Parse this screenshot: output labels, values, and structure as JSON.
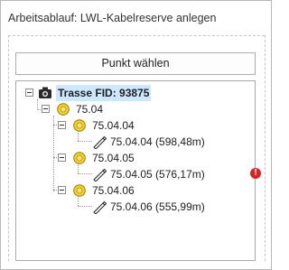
{
  "panel": {
    "title": "Arbeitsablauf: LWL-Kabelreserve anlegen"
  },
  "toolbar": {
    "select_point_label": "Punkt wählen"
  },
  "tree": {
    "root": {
      "label": "Trasse FID: 93875",
      "icon": "camera-icon"
    },
    "group": {
      "label": "75.04",
      "icon": "node-circle-icon"
    },
    "children": [
      {
        "label": "75.04.04",
        "icon": "node-circle-icon",
        "leaf": {
          "label": "75.04.04 (598,48m)",
          "icon": "cable-icon"
        }
      },
      {
        "label": "75.04.05",
        "icon": "node-circle-icon",
        "leaf": {
          "label": "75.04.05 (576,17m)",
          "icon": "cable-icon",
          "status": "error"
        }
      },
      {
        "label": "75.04.06",
        "icon": "node-circle-icon",
        "leaf": {
          "label": "75.04.06 (555,99m)",
          "icon": "cable-icon"
        }
      }
    ]
  },
  "colors": {
    "selection": "#cce8ff",
    "error": "#e02020",
    "node": "#f2c51b"
  }
}
